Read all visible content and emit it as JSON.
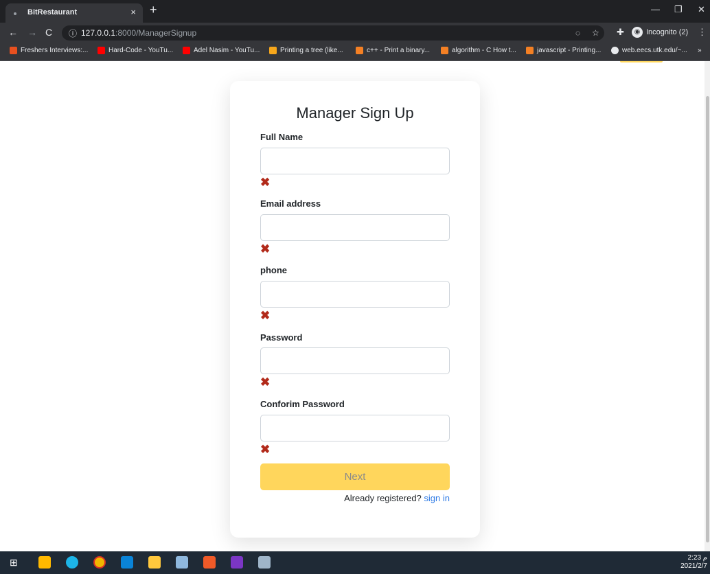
{
  "browser": {
    "tab_title": "BitRestaurant",
    "tab_close": "×",
    "new_tab": "+",
    "url_host": "127.0.0.1",
    "url_path": ":8000/ManagerSignup",
    "incognito_label": "Incognito (2)",
    "bookmarks": [
      {
        "label": "Freshers Interviews:...",
        "color": "#e8501f"
      },
      {
        "label": "Hard-Code - YouTu...",
        "color": "#ff0000"
      },
      {
        "label": "Adel Nasim - YouTu...",
        "color": "#ff0000"
      },
      {
        "label": "Printing a tree (like...",
        "color": "#f7a71b"
      },
      {
        "label": "c++ - Print a binary...",
        "color": "#f48024"
      },
      {
        "label": "algorithm - C How t...",
        "color": "#f48024"
      },
      {
        "label": "javascript - Printing...",
        "color": "#f48024"
      },
      {
        "label": "web.eecs.utk.edu/~...",
        "color": "#e8eaed"
      }
    ],
    "more_bookmarks": "»"
  },
  "form": {
    "title": "Manager Sign Up",
    "fields": [
      {
        "label": "Full Name"
      },
      {
        "label": "Email address"
      },
      {
        "label": "phone"
      },
      {
        "label": "Password"
      },
      {
        "label": "Conforim Password"
      }
    ],
    "error_icon": "✖",
    "next_label": "Next",
    "already_text": "Already registered?",
    "signin_link": "sign in"
  },
  "taskbar": {
    "time": "2:23 م",
    "date": "2021/2/7"
  },
  "colors": {
    "accent_button": "#ffd65c",
    "link": "#2f7be5",
    "error_icon": "#b22a1a"
  }
}
